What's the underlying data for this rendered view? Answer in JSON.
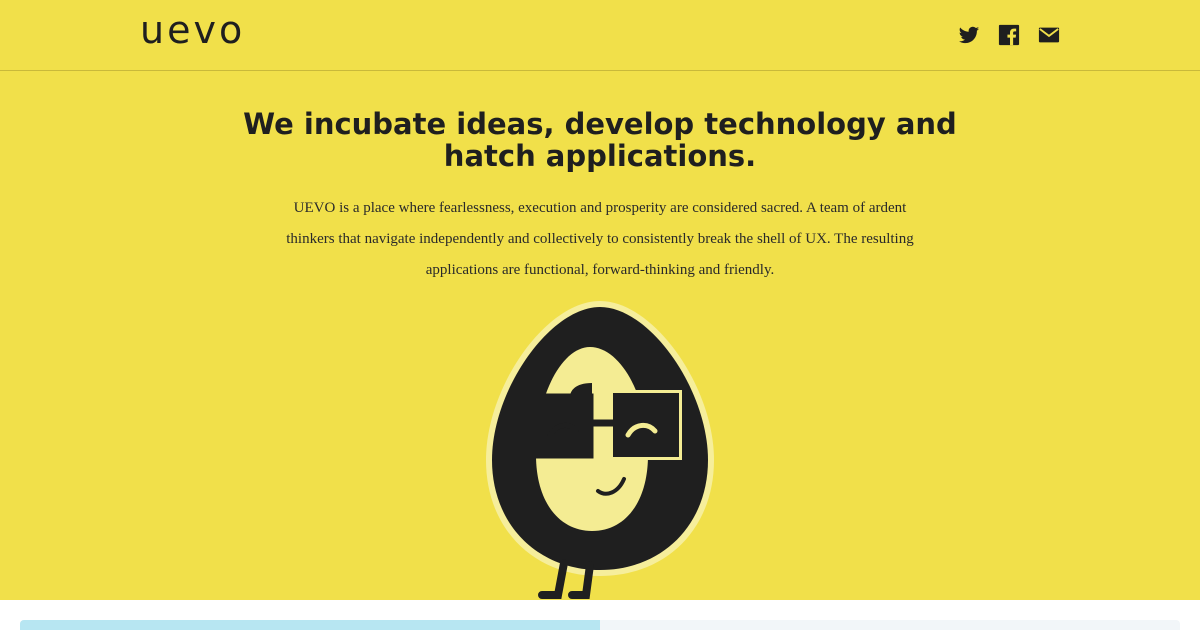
{
  "brand": {
    "logo_text": "uevo"
  },
  "social": [
    {
      "name": "twitter-icon",
      "label": "Twitter"
    },
    {
      "name": "facebook-icon",
      "label": "Facebook"
    },
    {
      "name": "mail-icon",
      "label": "Email"
    }
  ],
  "hero": {
    "headline_lines": [
      "We incubate ideas, develop technology and",
      "hatch applications."
    ],
    "description_lines": [
      "UEVO is a place where fearlessness, execution and prosperity are considered sacred. A team of ardent",
      "thinkers that navigate independently and collectively to consistently break the shell of UX. The resulting",
      "applications are functional, forward-thinking and friendly."
    ]
  },
  "colors": {
    "hero_background": "#f1e04a",
    "text": "#1f1f1f",
    "egg_shell": "#1f1f1f",
    "egg_face": "#f4ec93",
    "tab_active": "#b7e6f2",
    "tab_inactive": "#f2f6f9"
  }
}
